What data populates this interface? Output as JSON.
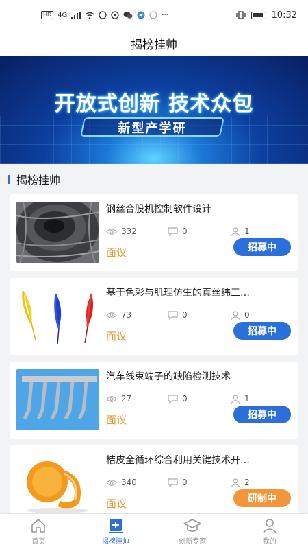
{
  "status_bar": {
    "left_badges": [
      "HD",
      "4G"
    ],
    "time": "10:32"
  },
  "nav": {
    "title": "揭榜挂帅"
  },
  "banner": {
    "headline": "开放式创新  技术众包",
    "tagline": "新型产学研"
  },
  "section": {
    "title": "揭榜挂帅"
  },
  "cards": [
    {
      "title": "钢丝合股机控制软件设计",
      "views": "332",
      "comments": "0",
      "participants": "1",
      "price": "面议",
      "status": "招募中",
      "status_color": "#2a6fda",
      "image": "steel-wire-image"
    },
    {
      "title": "基于色彩与肌理仿生的真丝纬三…",
      "views": "73",
      "comments": "0",
      "participants": "0",
      "price": "面议",
      "status": "招募中",
      "status_color": "#2a6fda",
      "image": "feathers-image"
    },
    {
      "title": "汽车线束端子的缺陷检测技术",
      "views": "27",
      "comments": "0",
      "participants": "1",
      "price": "面议",
      "status": "招募中",
      "status_color": "#2a6fda",
      "image": "wire-terminal-image"
    },
    {
      "title": "桔皮全循环综合利用关键技术开…",
      "views": "340",
      "comments": "0",
      "participants": "2",
      "price": "面议",
      "status": "研制中",
      "status_color": "#f3953b",
      "image": "orange-peel-image"
    }
  ],
  "tabbar": {
    "items": [
      {
        "label": "首页",
        "icon": "home-icon"
      },
      {
        "label": "揭榜挂帅",
        "icon": "plus-square-icon",
        "active": true
      },
      {
        "label": "创新专家",
        "icon": "graduation-cap-icon"
      },
      {
        "label": "我的",
        "icon": "user-icon"
      }
    ]
  },
  "colors": {
    "accent": "#2b6fd6",
    "price": "#e89a34",
    "status_recruiting": "#2a6fda",
    "status_developing": "#f3953b"
  }
}
